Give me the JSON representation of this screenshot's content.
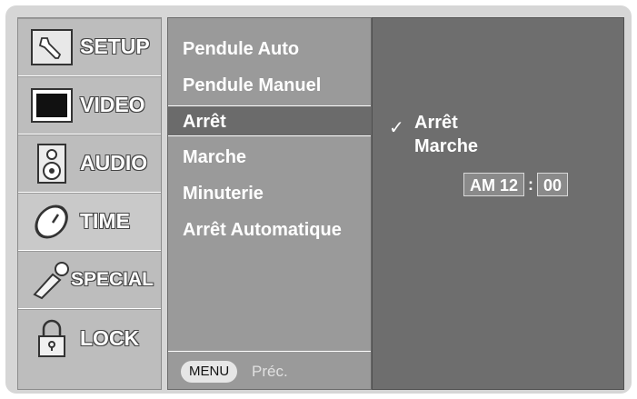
{
  "categories": [
    {
      "label": "SETUP",
      "icon": "wrench-icon"
    },
    {
      "label": "VIDEO",
      "icon": "monitor-icon"
    },
    {
      "label": "AUDIO",
      "icon": "speaker-icon"
    },
    {
      "label": "TIME",
      "icon": "clock-icon",
      "active": true
    },
    {
      "label": "SPECIAL",
      "icon": "key-icon"
    },
    {
      "label": "LOCK",
      "icon": "lock-icon"
    }
  ],
  "menu": {
    "items": [
      "Pendule Auto",
      "Pendule Manuel",
      "Arrêt",
      "Marche",
      "Minuterie",
      "Arrêt Automatique"
    ],
    "selected_index": 2,
    "menu_key": "MENU",
    "prev_label": "Préc."
  },
  "panel": {
    "options": [
      "Arrêt",
      "Marche"
    ],
    "checked_index": 0,
    "check_mark": "✓",
    "time": {
      "ampm": "AM",
      "hour": "12",
      "separator": ":",
      "minute": "00"
    }
  }
}
